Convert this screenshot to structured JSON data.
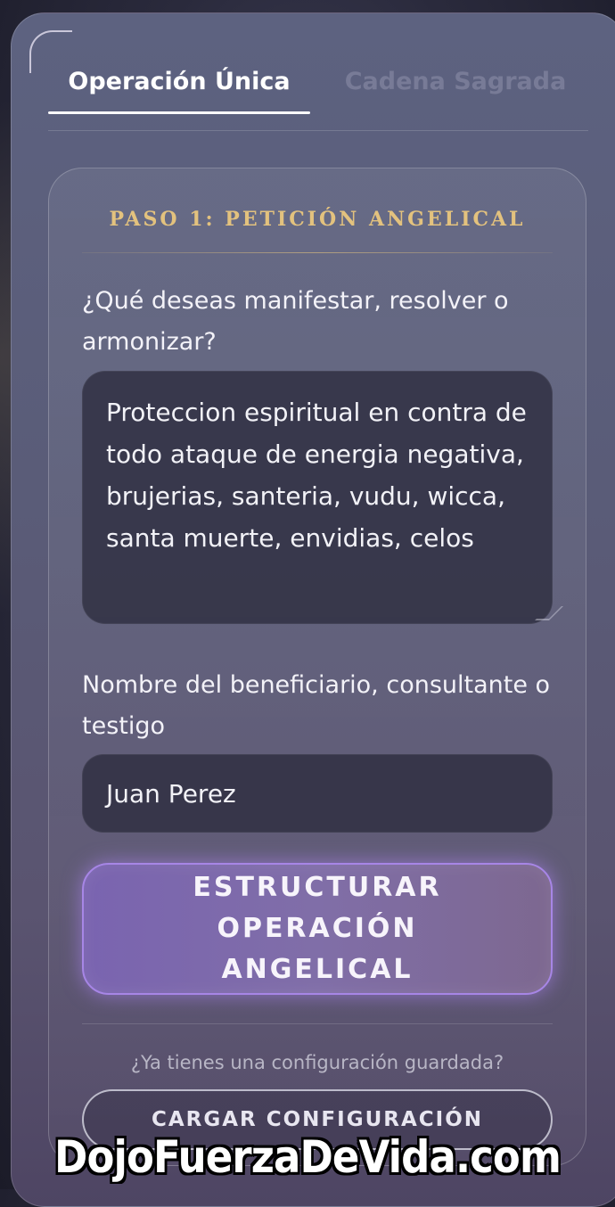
{
  "tabs": [
    {
      "label": "Operación Única",
      "active": true
    },
    {
      "label": "Cadena Sagrada",
      "active": false
    }
  ],
  "step": {
    "title": "PASO 1: PETICIÓN ANGELICAL"
  },
  "form": {
    "desire_label": "¿Qué deseas manifestar, resolver o armonizar?",
    "desire_value": "Proteccion espiritual en contra de todo ataque de energia negativa, brujerias, santeria, vudu, wicca, santa muerte, envidias, celos",
    "name_label": "Nombre del beneficiario, consultante o testigo",
    "name_value": "Juan Perez",
    "submit_label": "ESTRUCTURAR OPERACIÓN ANGELICAL"
  },
  "saved": {
    "prompt": "¿Ya tienes una configuración guardada?",
    "load_label": "CARGAR CONFIGURACIÓN"
  },
  "watermark": "DojoFuerzaDeVida.com",
  "colors": {
    "accent_gold": "#e3c27e",
    "button_purple": "#7a64b0",
    "button_glow": "#a786e6"
  }
}
